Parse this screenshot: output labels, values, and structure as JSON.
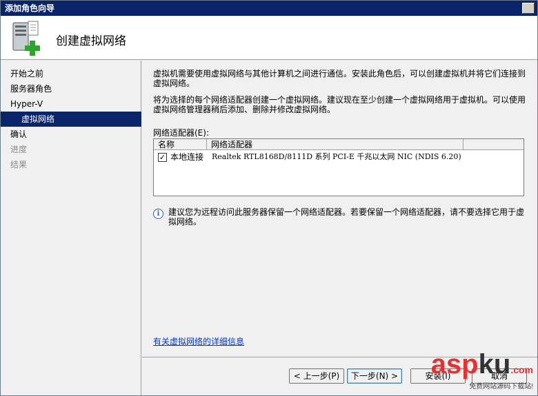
{
  "window": {
    "title": "添加角色向导"
  },
  "header": {
    "title": "创建虚拟网络",
    "icon": "server-add-icon"
  },
  "sidebar": {
    "items": [
      {
        "label": "开始之前",
        "state": "normal"
      },
      {
        "label": "服务器角色",
        "state": "normal"
      },
      {
        "label": "Hyper-V",
        "state": "normal"
      },
      {
        "label": "虚拟网络",
        "state": "active"
      },
      {
        "label": "确认",
        "state": "normal"
      },
      {
        "label": "进度",
        "state": "disabled"
      },
      {
        "label": "结果",
        "state": "disabled"
      }
    ]
  },
  "main": {
    "intro": "虚拟机需要使用虚拟网络与其他计算机之间进行通信。安装此角色后，可以创建虚拟机并将它们连接到虚拟网络。",
    "instruction": "将为选择的每个网络适配器创建一个虚拟网络。建议现在至少创建一个虚拟网络用于虚拟机。可以使用虚拟网络管理器稍后添加、删除并修改虚拟网络。",
    "list_label": "网络适配器(E):",
    "columns": [
      "名称",
      "网络适配器"
    ],
    "rows": [
      {
        "checked": true,
        "name": "本地连接",
        "adapter": "Realtek RTL8168D/8111D 系列 PCI-E 千兆以太网 NIC (NDIS 6.20)"
      }
    ],
    "info": "建议您为远程访问此服务器保留一个网络适配器。若要保留一个网络适配器，请不要选择它用于虚拟网络。",
    "more_link": "有关虚拟网络的详细信息"
  },
  "footer": {
    "prev": "< 上一步(P)",
    "next": "下一步(N) >",
    "install": "安装(I)",
    "cancel": "取消"
  },
  "watermark": {
    "brand_a": "asp",
    "brand_b": "ku",
    "brand_c": ".com",
    "tagline": "免费网站源码下载站!"
  },
  "colors": {
    "selection": "#0a246a",
    "link": "#0033cc",
    "watermark_red": "#e53131"
  }
}
